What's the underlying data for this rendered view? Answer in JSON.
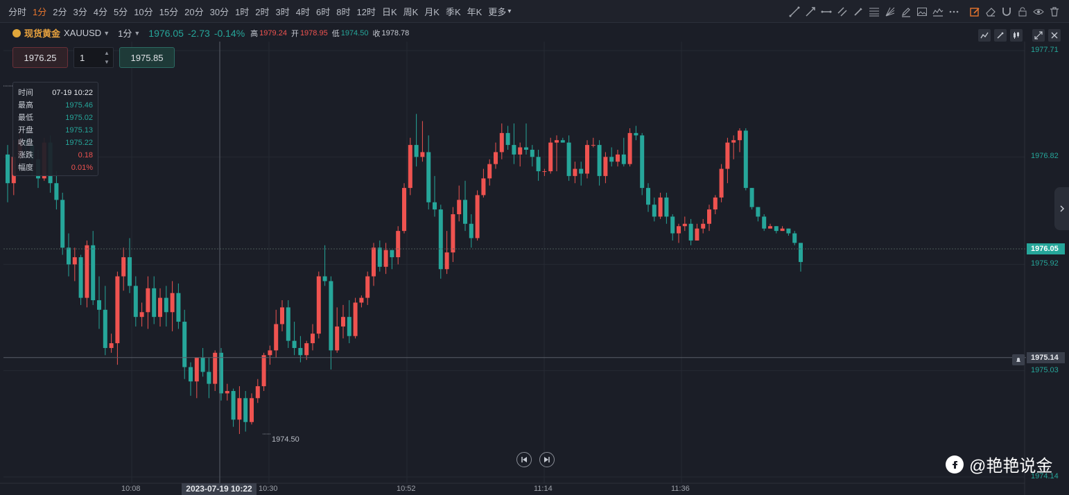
{
  "toolbar": {
    "timeframes": [
      "分时",
      "1分",
      "2分",
      "3分",
      "4分",
      "5分",
      "10分",
      "15分",
      "20分",
      "30分",
      "1时",
      "2时",
      "3时",
      "4时",
      "6时",
      "8时",
      "12时",
      "日K",
      "周K",
      "月K",
      "季K",
      "年K",
      "更多"
    ],
    "active_timeframe": "1分",
    "tools": [
      "trend-line-icon",
      "ray-line-icon",
      "horizontal-line-icon",
      "parallel-channel-icon",
      "brush-icon",
      "fibonacci-icon",
      "fan-icon",
      "pencil-icon",
      "image-icon",
      "wave-icon",
      "more-dots-icon",
      "edit-icon",
      "eraser-icon",
      "magnet-icon",
      "lock-icon",
      "eye-icon",
      "trash-icon"
    ]
  },
  "header": {
    "symbol_name": "现货黄金",
    "symbol_code": "XAUUSD",
    "interval": "1分",
    "last": "1976.05",
    "change": "-2.73",
    "change_pct": "-0.14%",
    "high_label": "高",
    "high": "1979.24",
    "open_label": "开",
    "open": "1978.95",
    "low_label": "低",
    "low": "1974.50",
    "close_label": "收",
    "close": "1978.78",
    "buttons": [
      "indicator-icon",
      "draw-icon",
      "candle-type-icon",
      "fullscreen-icon",
      "close-icon"
    ]
  },
  "trade": {
    "sell_price": "1976.25",
    "quantity": "1",
    "buy_price": "1975.85"
  },
  "tooltip": [
    {
      "k": "时间",
      "v": "07-19 10:22",
      "c": ""
    },
    {
      "k": "最高",
      "v": "1975.46",
      "c": "g"
    },
    {
      "k": "最低",
      "v": "1975.02",
      "c": "g"
    },
    {
      "k": "开盘",
      "v": "1975.13",
      "c": "g"
    },
    {
      "k": "收盘",
      "v": "1975.22",
      "c": "g"
    },
    {
      "k": "涨跌",
      "v": "0.18",
      "c": "r"
    },
    {
      "k": "幅度",
      "v": "0.01%",
      "c": "r"
    }
  ],
  "colors": {
    "up": "#ef5350",
    "down": "#26a69a",
    "background": "#1b1e27",
    "grid": "#2a2e38",
    "accent": "#e8752e"
  },
  "chart_data": {
    "type": "candlestick",
    "y_ticks": [
      "1977.71",
      "1976.82",
      "1975.92",
      "1975.03",
      "1974.14"
    ],
    "ylim": [
      1974.14,
      1977.71
    ],
    "current_price": "1976.05",
    "crosshair_price": "1975.14",
    "x_ticks": [
      "10:08",
      "10:30",
      "10:52",
      "11:14",
      "11:36"
    ],
    "crosshair_time": "2023-07-19 10:22",
    "min_label": "1974.50",
    "ohlc": [
      [
        1976.84,
        1976.92,
        1976.44,
        1976.6
      ],
      [
        1976.6,
        1976.96,
        1976.5,
        1976.82
      ],
      [
        1976.82,
        1977.04,
        1976.76,
        1976.96
      ],
      [
        1976.96,
        1977.06,
        1976.8,
        1976.92
      ],
      [
        1976.92,
        1977.0,
        1976.66,
        1976.8
      ],
      [
        1976.8,
        1976.88,
        1976.56,
        1976.64
      ],
      [
        1976.64,
        1976.98,
        1976.62,
        1976.94
      ],
      [
        1976.94,
        1977.0,
        1976.52,
        1976.6
      ],
      [
        1976.6,
        1976.7,
        1976.38,
        1976.46
      ],
      [
        1976.46,
        1976.52,
        1976.0,
        1976.06
      ],
      [
        1976.06,
        1976.18,
        1975.82,
        1975.92
      ],
      [
        1975.92,
        1976.06,
        1975.78,
        1975.98
      ],
      [
        1975.98,
        1976.0,
        1975.58,
        1975.64
      ],
      [
        1975.64,
        1976.12,
        1975.56,
        1976.08
      ],
      [
        1976.08,
        1976.2,
        1975.58,
        1975.62
      ],
      [
        1975.62,
        1975.82,
        1975.38,
        1975.54
      ],
      [
        1975.54,
        1975.74,
        1975.16,
        1975.22
      ],
      [
        1975.22,
        1975.34,
        1975.18,
        1975.26
      ],
      [
        1975.26,
        1975.86,
        1975.08,
        1975.82
      ],
      [
        1975.82,
        1976.06,
        1975.7,
        1975.98
      ],
      [
        1975.98,
        1976.14,
        1975.68,
        1975.74
      ],
      [
        1975.74,
        1975.82,
        1975.4,
        1975.48
      ],
      [
        1975.48,
        1975.6,
        1975.4,
        1975.52
      ],
      [
        1975.52,
        1975.82,
        1975.38,
        1975.72
      ],
      [
        1975.72,
        1975.82,
        1975.42,
        1975.48
      ],
      [
        1975.48,
        1975.72,
        1975.4,
        1975.64
      ],
      [
        1975.64,
        1975.74,
        1975.4,
        1975.52
      ],
      [
        1975.52,
        1975.78,
        1975.36,
        1975.68
      ],
      [
        1975.68,
        1975.76,
        1975.38,
        1975.44
      ],
      [
        1975.44,
        1975.54,
        1974.96,
        1975.06
      ],
      [
        1975.06,
        1975.1,
        1974.82,
        1974.94
      ],
      [
        1974.94,
        1975.14,
        1974.8,
        1975.14
      ],
      [
        1975.14,
        1975.22,
        1974.98,
        1975.02
      ],
      [
        1975.02,
        1975.14,
        1974.8,
        1974.92
      ],
      [
        1974.92,
        1975.2,
        1974.86,
        1975.18
      ],
      [
        1975.18,
        1975.22,
        1974.78,
        1974.84
      ],
      [
        1974.84,
        1974.92,
        1974.78,
        1974.86
      ],
      [
        1974.86,
        1974.88,
        1974.56,
        1974.62
      ],
      [
        1974.62,
        1974.9,
        1974.5,
        1974.8
      ],
      [
        1974.8,
        1974.86,
        1974.52,
        1974.6
      ],
      [
        1974.6,
        1974.84,
        1974.58,
        1974.8
      ],
      [
        1974.8,
        1974.96,
        1974.76,
        1974.9
      ],
      [
        1974.9,
        1975.18,
        1974.86,
        1975.16
      ],
      [
        1975.16,
        1975.24,
        1975.08,
        1975.2
      ],
      [
        1975.2,
        1975.54,
        1975.14,
        1975.42
      ],
      [
        1975.42,
        1975.62,
        1975.36,
        1975.56
      ],
      [
        1975.56,
        1975.62,
        1975.22,
        1975.28
      ],
      [
        1975.28,
        1975.44,
        1975.16,
        1975.22
      ],
      [
        1975.22,
        1975.32,
        1975.1,
        1975.16
      ],
      [
        1975.16,
        1975.28,
        1975.12,
        1975.26
      ],
      [
        1975.26,
        1975.42,
        1975.2,
        1975.34
      ],
      [
        1975.34,
        1975.86,
        1975.3,
        1975.82
      ],
      [
        1975.82,
        1976.08,
        1975.74,
        1975.78
      ],
      [
        1975.78,
        1975.82,
        1975.04,
        1975.2
      ],
      [
        1975.2,
        1975.56,
        1975.18,
        1975.4
      ],
      [
        1975.4,
        1975.58,
        1975.3,
        1975.48
      ],
      [
        1975.48,
        1975.62,
        1975.26,
        1975.32
      ],
      [
        1975.32,
        1975.64,
        1975.3,
        1975.6
      ],
      [
        1975.6,
        1975.66,
        1975.56,
        1975.64
      ],
      [
        1975.64,
        1975.86,
        1975.58,
        1975.82
      ],
      [
        1975.82,
        1976.1,
        1975.74,
        1976.06
      ],
      [
        1976.06,
        1976.12,
        1975.86,
        1975.9
      ],
      [
        1975.9,
        1976.1,
        1975.84,
        1976.04
      ],
      [
        1976.04,
        1976.04,
        1975.88,
        1975.98
      ],
      [
        1975.98,
        1976.24,
        1975.92,
        1976.2
      ],
      [
        1976.2,
        1976.6,
        1976.18,
        1976.56
      ],
      [
        1976.56,
        1976.98,
        1976.5,
        1976.92
      ],
      [
        1976.92,
        1977.18,
        1976.74,
        1976.82
      ],
      [
        1976.82,
        1977.12,
        1976.78,
        1976.86
      ],
      [
        1976.86,
        1977.0,
        1976.38,
        1976.44
      ],
      [
        1976.44,
        1976.66,
        1976.32,
        1976.38
      ],
      [
        1976.38,
        1976.42,
        1975.8,
        1975.88
      ],
      [
        1975.88,
        1976.2,
        1975.84,
        1976.02
      ],
      [
        1976.02,
        1976.4,
        1975.94,
        1976.34
      ],
      [
        1976.34,
        1976.58,
        1976.28,
        1976.46
      ],
      [
        1976.46,
        1976.62,
        1976.2,
        1976.26
      ],
      [
        1976.26,
        1976.34,
        1976.06,
        1976.14
      ],
      [
        1976.14,
        1976.54,
        1976.12,
        1976.5
      ],
      [
        1976.5,
        1976.72,
        1976.48,
        1976.64
      ],
      [
        1976.64,
        1976.8,
        1976.58,
        1976.76
      ],
      [
        1976.76,
        1976.94,
        1976.72,
        1976.86
      ],
      [
        1976.86,
        1977.1,
        1976.8,
        1977.02
      ],
      [
        1977.02,
        1977.08,
        1976.88,
        1976.92
      ],
      [
        1976.92,
        1977.1,
        1976.76,
        1976.84
      ],
      [
        1976.84,
        1976.94,
        1976.74,
        1976.9
      ],
      [
        1976.9,
        1977.1,
        1976.84,
        1976.88
      ],
      [
        1976.88,
        1976.92,
        1976.74,
        1976.82
      ],
      [
        1976.82,
        1976.88,
        1976.62,
        1976.7
      ],
      [
        1976.7,
        1976.72,
        1976.66,
        1976.7
      ],
      [
        1976.7,
        1976.98,
        1976.68,
        1976.94
      ],
      [
        1976.94,
        1977.0,
        1976.7,
        1976.96
      ],
      [
        1976.96,
        1976.98,
        1976.94,
        1976.94
      ],
      [
        1976.94,
        1977.0,
        1976.62,
        1976.66
      ],
      [
        1976.66,
        1976.78,
        1976.6,
        1976.72
      ],
      [
        1976.72,
        1976.78,
        1976.58,
        1976.68
      ],
      [
        1976.68,
        1976.96,
        1976.64,
        1976.92
      ],
      [
        1976.92,
        1976.98,
        1976.9,
        1976.92
      ],
      [
        1976.92,
        1976.96,
        1976.58,
        1976.66
      ],
      [
        1976.66,
        1976.86,
        1976.6,
        1976.82
      ],
      [
        1976.82,
        1976.9,
        1976.74,
        1976.78
      ],
      [
        1976.78,
        1976.88,
        1976.74,
        1976.84
      ],
      [
        1976.84,
        1976.98,
        1976.74,
        1976.76
      ],
      [
        1976.76,
        1977.06,
        1976.74,
        1977.02
      ],
      [
        1977.02,
        1977.08,
        1976.96,
        1977.0
      ],
      [
        1977.0,
        1977.02,
        1976.5,
        1976.56
      ],
      [
        1976.56,
        1976.6,
        1976.36,
        1976.42
      ],
      [
        1976.42,
        1976.48,
        1976.28,
        1976.32
      ],
      [
        1976.32,
        1976.52,
        1976.3,
        1976.48
      ],
      [
        1976.48,
        1976.52,
        1976.26,
        1976.32
      ],
      [
        1976.32,
        1976.34,
        1976.12,
        1976.18
      ],
      [
        1976.18,
        1976.26,
        1976.1,
        1976.24
      ],
      [
        1976.24,
        1976.32,
        1976.2,
        1976.26
      ],
      [
        1976.26,
        1976.3,
        1976.08,
        1976.12
      ],
      [
        1976.12,
        1976.26,
        1976.12,
        1976.22
      ],
      [
        1976.22,
        1976.3,
        1976.18,
        1976.26
      ],
      [
        1976.26,
        1976.42,
        1976.2,
        1976.38
      ],
      [
        1976.38,
        1976.5,
        1976.34,
        1976.48
      ],
      [
        1976.48,
        1976.76,
        1976.44,
        1976.72
      ],
      [
        1976.72,
        1976.98,
        1976.6,
        1976.94
      ],
      [
        1976.94,
        1977.0,
        1976.8,
        1976.96
      ],
      [
        1976.96,
        1977.06,
        1976.86,
        1977.04
      ],
      [
        1977.04,
        1977.06,
        1976.54,
        1976.56
      ],
      [
        1976.56,
        1976.56,
        1976.38,
        1976.4
      ],
      [
        1976.4,
        1976.4,
        1976.28,
        1976.32
      ],
      [
        1976.32,
        1976.34,
        1976.2,
        1976.22
      ],
      [
        1976.22,
        1976.26,
        1976.22,
        1976.24
      ],
      [
        1976.24,
        1976.24,
        1976.18,
        1976.2
      ],
      [
        1976.2,
        1976.24,
        1976.2,
        1976.22
      ],
      [
        1976.22,
        1976.22,
        1976.16,
        1976.18
      ],
      [
        1976.18,
        1976.2,
        1976.08,
        1976.1
      ],
      [
        1976.1,
        1976.1,
        1975.86,
        1975.94
      ]
    ]
  },
  "watermark": "@艳艳说金"
}
